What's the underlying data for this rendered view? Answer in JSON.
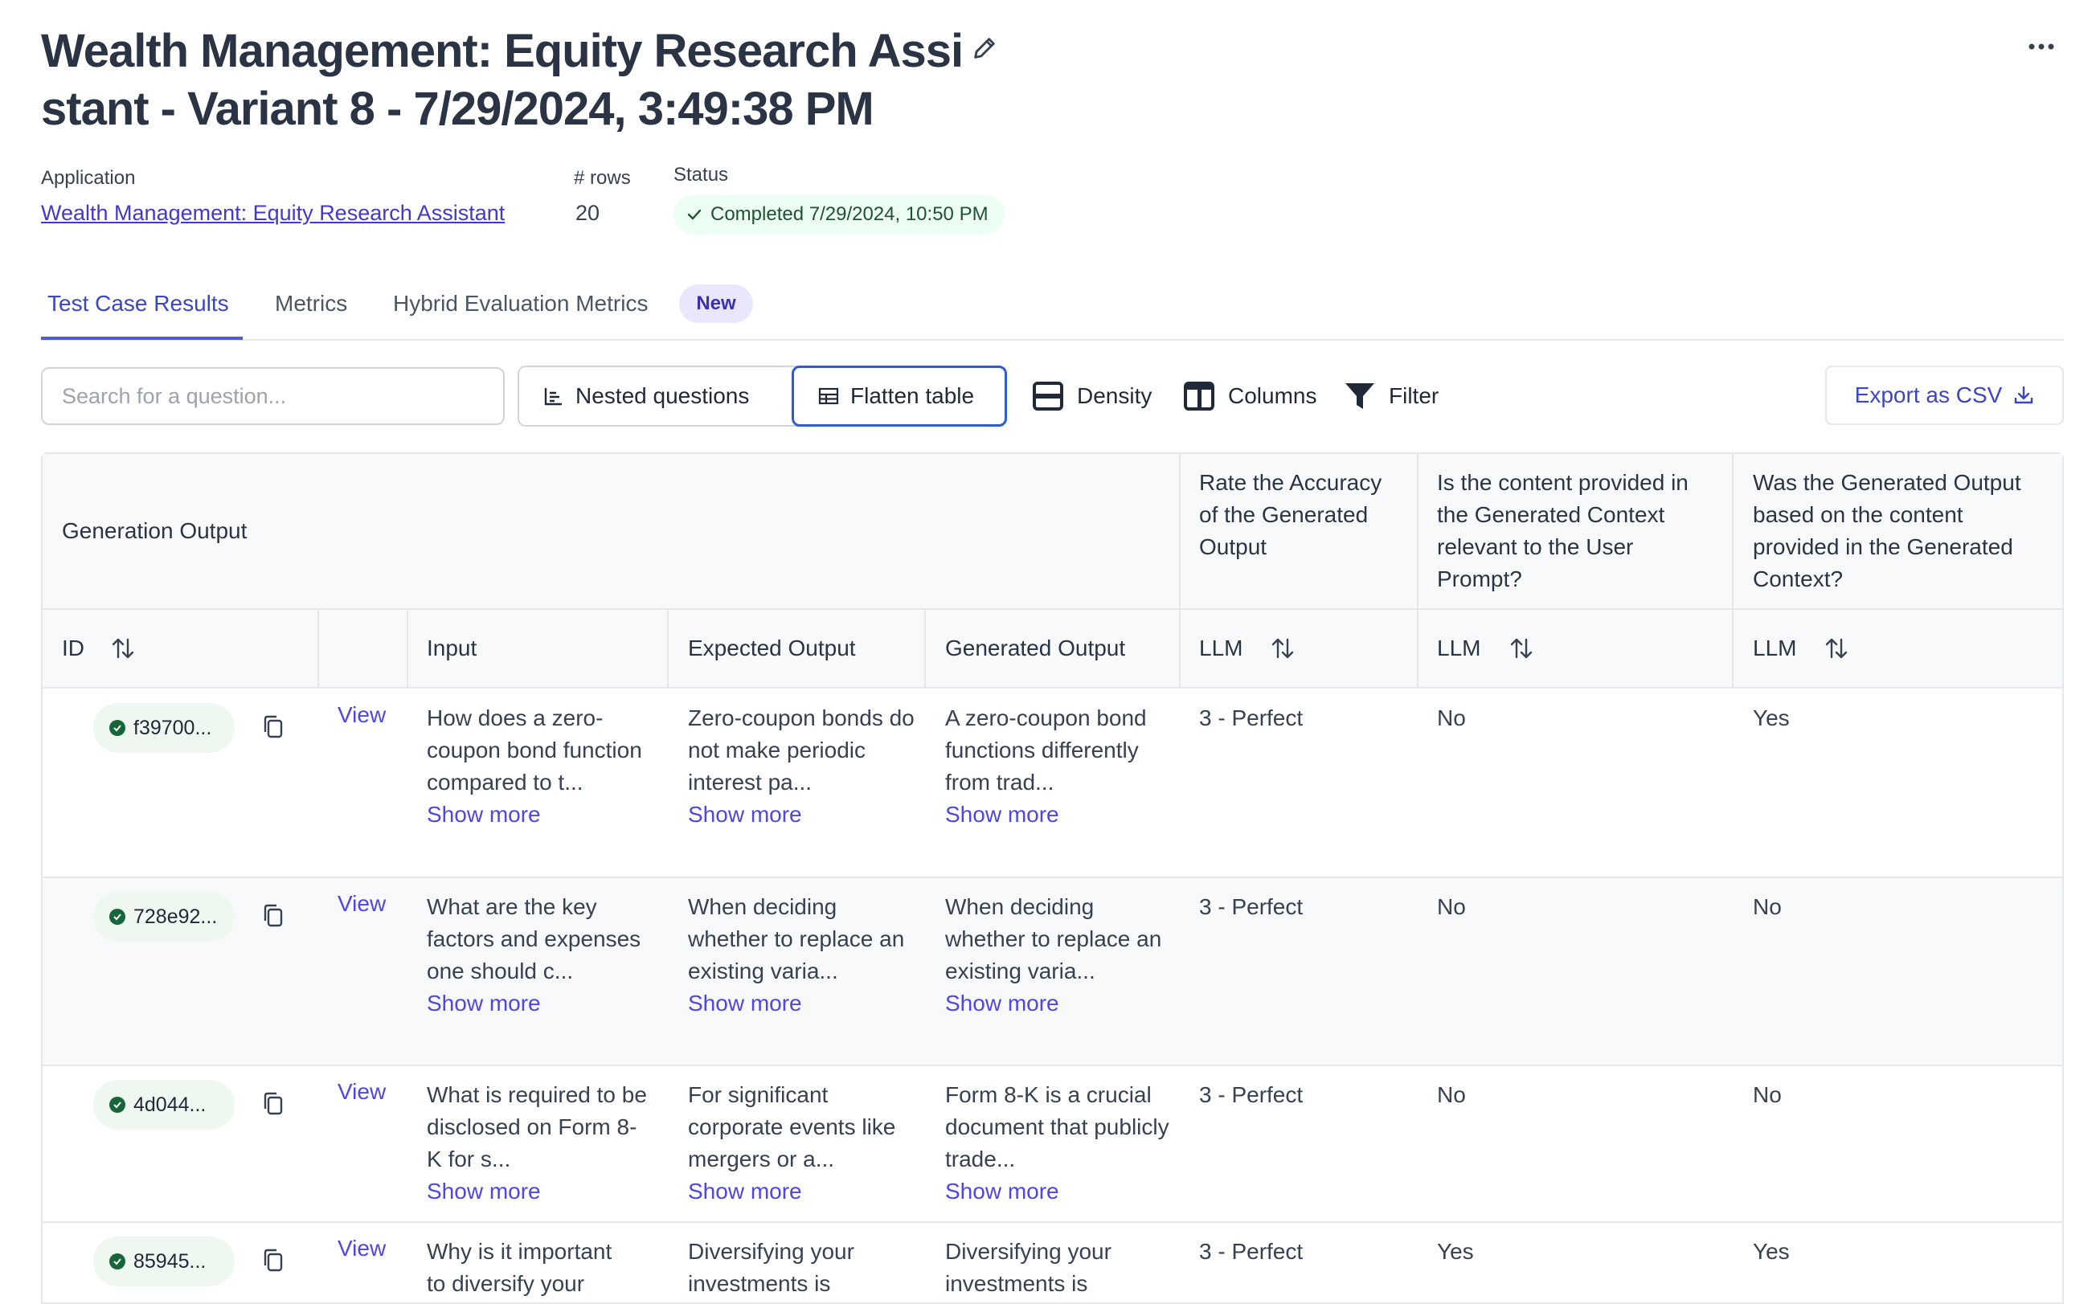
{
  "header": {
    "title": "Wealth Management: Equity Research Assistant - Variant 8 - 7/29/2024, 3:49:38 PM"
  },
  "meta": {
    "application_label": "Application",
    "application_value": "Wealth Management: Equity Research Assistant",
    "rows_label": "# rows",
    "rows_value": "20",
    "status_label": "Status",
    "status_value": "Completed 7/29/2024, 10:50 PM"
  },
  "tabs": [
    {
      "label": "Test Case Results",
      "active": true
    },
    {
      "label": "Metrics",
      "active": false
    },
    {
      "label": "Hybrid Evaluation Metrics",
      "active": false
    }
  ],
  "new_badge": "New",
  "toolbar": {
    "search_placeholder": "Search for a question...",
    "nested_label": "Nested questions",
    "flatten_label": "Flatten table",
    "density_label": "Density",
    "columns_label": "Columns",
    "filter_label": "Filter",
    "export_label": "Export as CSV"
  },
  "table": {
    "group_header": "Generation Output",
    "metric_headers": [
      "Rate the Accuracy of the Generated Output",
      "Is the content provided in the Generated Context relevant to the User Prompt?",
      "Was the Generated Output based on the content provided in the Generated Context?"
    ],
    "columns": {
      "id": "ID",
      "input": "Input",
      "expected": "Expected Output",
      "generated": "Generated Output",
      "llm": "LLM"
    },
    "view_label": "View",
    "show_more_label": "Show more",
    "rows": [
      {
        "id": "f39700...",
        "input": "How does a zero-coupon bond function compared to t...",
        "expected": "Zero-coupon bonds do not make periodic interest pa...",
        "generated": "A zero-coupon bond functions differently from trad...",
        "m1": "3 - Perfect",
        "m2": "No",
        "m3": "Yes"
      },
      {
        "id": "728e92...",
        "input": "What are the key factors and expenses one should c...",
        "expected": "When deciding whether to replace an existing varia...",
        "generated": "When deciding whether to replace an existing varia...",
        "m1": "3 - Perfect",
        "m2": "No",
        "m3": "No"
      },
      {
        "id": "4d044...",
        "input": "What is required to be disclosed on Form 8-K for s...",
        "expected": "For significant corporate events like mergers or a...",
        "generated": "Form 8-K is a crucial document that publicly trade...",
        "m1": "3 - Perfect",
        "m2": "No",
        "m3": "No"
      },
      {
        "id": "85945...",
        "input": "Why is it important to diversify your",
        "expected": "Diversifying your investments is",
        "generated": "Diversifying your investments is",
        "m1": "3 - Perfect",
        "m2": "Yes",
        "m3": "Yes"
      }
    ]
  },
  "colors": {
    "accent": "#4f46e5",
    "tab_active": "#3b46c4",
    "success": "#17663a"
  }
}
